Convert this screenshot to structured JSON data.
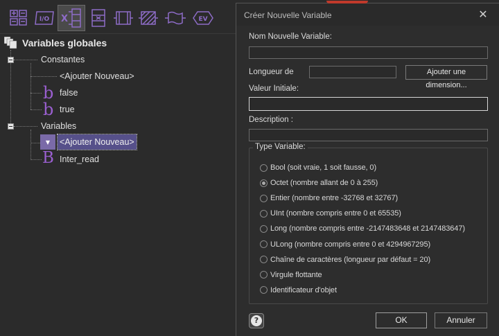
{
  "tree": {
    "root_label": "Variables globales",
    "constants_label": "Constantes",
    "constants_add": "<Ajouter Nouveau>",
    "const_false": "false",
    "const_true": "true",
    "variables_label": "Variables",
    "variables_add": "<Ajouter Nouveau>",
    "var_inter_read": "Inter_read",
    "bool_glyph": "b",
    "byte_glyph": "B"
  },
  "toolbar": {
    "io_label": "I/O",
    "ev_label": "EV",
    "x_label": "X"
  },
  "dialog": {
    "title": "Créer Nouvelle Variable",
    "close_glyph": "✕",
    "name_label": "Nom Nouvelle Variable:",
    "name_value": "",
    "length_label": "Longueur de",
    "length_value": "",
    "add_dimension_label": "Ajouter une dimension...",
    "initial_value_label": "Valeur Initiale:",
    "initial_value": "",
    "description_label": "Description :",
    "description_value": "",
    "type_group_label": "Type Variable:",
    "types": [
      {
        "label": "Bool (soit vraie, 1 soit fausse, 0)",
        "checked": false
      },
      {
        "label": "Octet (nombre allant de 0 à 255)",
        "checked": true
      },
      {
        "label": "Entier (nombre entre -32768 et 32767)",
        "checked": false
      },
      {
        "label": "UInt (nombre compris entre 0 et 65535)",
        "checked": false
      },
      {
        "label": "Long (nombre compris entre -2147483648 et 2147483647)",
        "checked": false
      },
      {
        "label": "ULong (nombre compris entre 0 et 4294967295)",
        "checked": false
      },
      {
        "label": "Chaîne de caractères (longueur par défaut = 20)",
        "checked": false
      },
      {
        "label": "Virgule flottante",
        "checked": false
      },
      {
        "label": "Identificateur d'objet",
        "checked": false
      }
    ],
    "help_glyph": "?",
    "ok_label": "OK",
    "cancel_label": "Annuler"
  },
  "colors": {
    "accent_purple": "#8e6cc8",
    "selection": "#56508a",
    "background": "#2b2b2b"
  }
}
